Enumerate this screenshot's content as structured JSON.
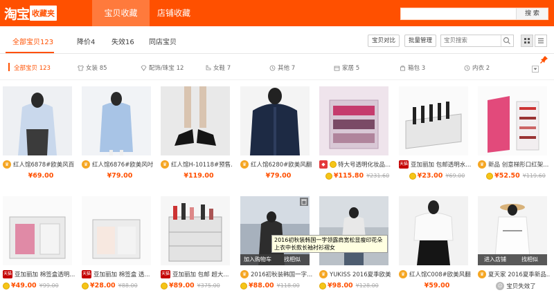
{
  "header": {
    "logo_main": "淘宝",
    "logo_sub": "收藏夹",
    "tabs": [
      {
        "label": "宝贝收藏",
        "active": true
      },
      {
        "label": "店铺收藏",
        "active": false
      }
    ],
    "search_button": "搜 索",
    "search_value": ""
  },
  "filter": {
    "tabs": [
      {
        "label": "全部宝贝123",
        "active": true
      },
      {
        "label": "降价4",
        "active": false
      },
      {
        "label": "失效16",
        "active": false
      },
      {
        "label": "同店宝贝",
        "active": false
      }
    ],
    "compare_button": "宝贝对比",
    "manage_button": "批量管理",
    "search_placeholder": "宝贝搜索"
  },
  "categories": [
    {
      "label": "全部宝贝 123",
      "icon": "none",
      "active": true
    },
    {
      "label": "女装 85",
      "icon": "shirt-icon"
    },
    {
      "label": "配饰/珠宝 12",
      "icon": "jewelry-icon"
    },
    {
      "label": "女鞋 7",
      "icon": "shoe-icon"
    },
    {
      "label": "其他 7",
      "icon": "other-icon"
    },
    {
      "label": "家居 5",
      "icon": "home-icon"
    },
    {
      "label": "箱包 3",
      "icon": "bag-icon"
    },
    {
      "label": "内衣 2",
      "icon": "underwear-icon"
    }
  ],
  "items_row1": [
    {
      "title": "红人馆6878#欧美风百...",
      "price": "¥69.00",
      "old": "",
      "badge": "crown",
      "coin": false
    },
    {
      "title": "红人馆6876#欧美风吋...",
      "price": "¥79.00",
      "old": "",
      "badge": "crown",
      "coin": false
    },
    {
      "title": "红人馆H-10118#预售...",
      "price": "¥119.00",
      "old": "",
      "badge": "crown",
      "coin": false
    },
    {
      "title": "红人馆6280#欧美风翻...",
      "price": "¥79.00",
      "old": "",
      "badge": "crown",
      "coin": false
    },
    {
      "title": "特大号透明化妆品...",
      "price": "¥115.80",
      "old": "¥231.60",
      "badge": "red",
      "coin": true
    },
    {
      "title": "亚加丽加 包邮透明水...",
      "price": "¥23.00",
      "old": "¥69.00",
      "badge": "tmall",
      "coin": true
    },
    {
      "title": "新品 创意梯形口红架...",
      "price": "¥52.50",
      "old": "¥119.60",
      "badge": "crown",
      "coin": true
    }
  ],
  "items_row2": [
    {
      "title": "亚加丽加 棉签盒透明...",
      "price": "¥49.00",
      "old": "¥99.00",
      "badge": "tmall",
      "coin": true
    },
    {
      "title": "亚加丽加 棉签盒 透...",
      "price": "¥28.00",
      "old": "¥88.00",
      "badge": "tmall",
      "coin": true
    },
    {
      "title": "亚加丽加 包邮 超大...",
      "price": "¥89.00",
      "old": "¥375.00",
      "badge": "tmall",
      "coin": true
    },
    {
      "title": "2016初秋装韩国一字...",
      "price": "¥88.00",
      "old": "¥118.00",
      "badge": "crown",
      "coin": true
    },
    {
      "title": "YUKISS 2016夏季欧美...",
      "price": "¥98.00",
      "old": "¥128.00",
      "badge": "crown",
      "coin": true
    },
    {
      "title": "红人馆C008#欧美风翻...",
      "price": "¥59.00",
      "old": "",
      "badge": "crown",
      "coin": false
    },
    {
      "title": "夏天家 2016夏季新品...",
      "price": "宝贝失效了",
      "old": "",
      "badge": "crown",
      "coin": false,
      "invalid": true
    }
  ],
  "hover": {
    "add_cart": "加入购物车",
    "find_similar": "找相似"
  },
  "hover_shop": {
    "enter_shop": "进入店铺",
    "find_similar": "找相似"
  },
  "tooltip": "2016初秋装韩国一字领露肩宽松显瘦印花朵上衣中长款长袖衬衫褶女",
  "colors": {
    "brand": "#ff5000",
    "accent": "#ff7a3c"
  }
}
